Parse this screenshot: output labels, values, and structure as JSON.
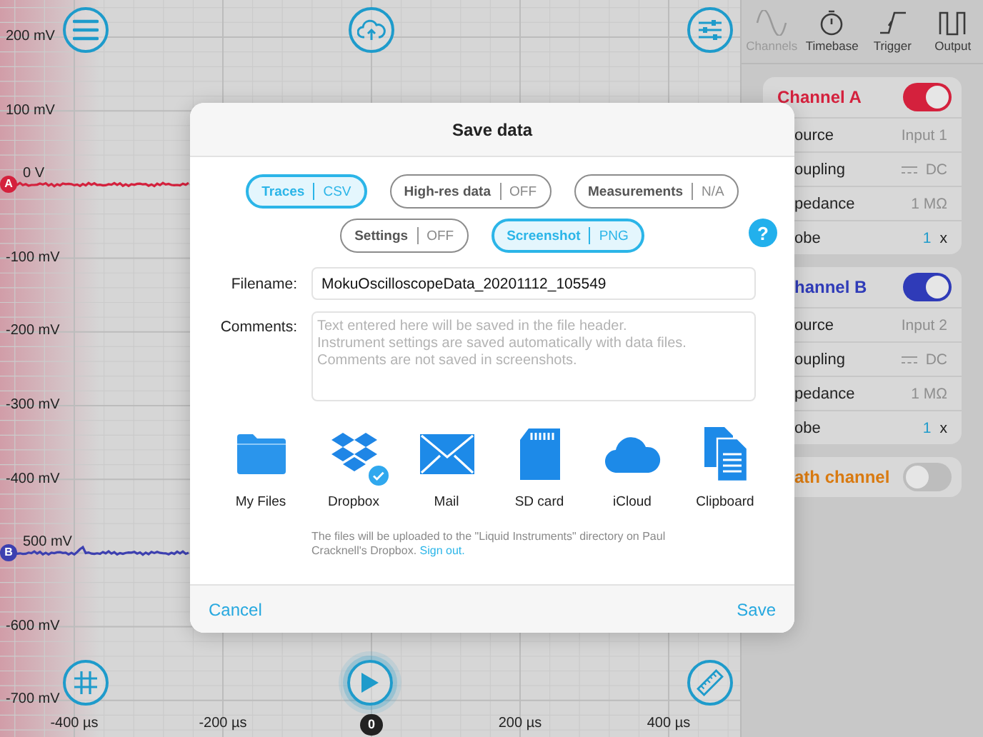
{
  "plot": {
    "y_labels": [
      {
        "text": "200 mV"
      },
      {
        "text": "100 mV"
      },
      {
        "text": "0 V",
        "trace": {
          "marker": "A",
          "color": "#d4213d"
        }
      },
      {
        "text": "-100 mV"
      },
      {
        "text": "-200 mV"
      },
      {
        "text": "-300 mV"
      },
      {
        "text": "-400 mV"
      },
      {
        "text": "500 mV",
        "trace": {
          "marker": "B",
          "color": "#3d40b0"
        }
      },
      {
        "text": "-600 mV"
      },
      {
        "text": "-700 mV"
      }
    ],
    "x_labels": [
      {
        "text": "-400 µs",
        "kind": "tick"
      },
      {
        "text": "-200 µs",
        "kind": "tick"
      },
      {
        "text": "0",
        "kind": "cursor"
      },
      {
        "text": "200 µs",
        "kind": "tick"
      },
      {
        "text": "400 µs",
        "kind": "tick"
      }
    ]
  },
  "panel": {
    "tabs": [
      {
        "label": "Channels",
        "kind": "sine",
        "selected": true
      },
      {
        "label": "Timebase",
        "kind": "stopwatch",
        "selected": false
      },
      {
        "label": "Trigger",
        "kind": "edge",
        "selected": false
      },
      {
        "label": "Output",
        "kind": "pulse",
        "selected": false
      }
    ],
    "channels": [
      {
        "title": "Channel A",
        "color": "#d4213d",
        "on": true,
        "rows": [
          {
            "kind": "text",
            "label": "ource",
            "value": "Input 1"
          },
          {
            "kind": "coupling",
            "label": "oupling",
            "value": "DC"
          },
          {
            "kind": "text",
            "label": "pedance",
            "value": "1 MΩ"
          },
          {
            "kind": "probe",
            "label": "obe",
            "value": "1",
            "unit": "x"
          }
        ]
      },
      {
        "title": "hannel B",
        "color": "#2f3bb8",
        "on": true,
        "rows": [
          {
            "kind": "text",
            "label": "ource",
            "value": "Input 2"
          },
          {
            "kind": "coupling",
            "label": "oupling",
            "value": "DC"
          },
          {
            "kind": "text",
            "label": "pedance",
            "value": "1 MΩ"
          },
          {
            "kind": "probe",
            "label": "obe",
            "value": "1",
            "unit": "x"
          }
        ]
      },
      {
        "title": "ath channel",
        "color": "#d97a10",
        "on": false
      }
    ]
  },
  "dialog": {
    "title": "Save data",
    "help": "?",
    "options": [
      {
        "label": "Traces",
        "value": "CSV",
        "selected": true
      },
      {
        "label": "High-res data",
        "value": "OFF",
        "selected": false
      },
      {
        "label": "Measurements",
        "value": "N/A",
        "selected": false
      },
      {
        "label": "Settings",
        "value": "OFF",
        "selected": false
      },
      {
        "label": "Screenshot",
        "value": "PNG",
        "selected": true
      }
    ],
    "filename": {
      "label": "Filename:",
      "value": "MokuOscilloscopeData_20201112_105549"
    },
    "comments": {
      "label": "Comments:",
      "placeholder": "Text entered here will be saved in the file header.\nInstrument settings are saved automatically with data files.\nComments are not saved in screenshots."
    },
    "destinations": [
      {
        "label": "My Files",
        "kind": "folder",
        "selected": false
      },
      {
        "label": "Dropbox",
        "kind": "boxes",
        "selected": true
      },
      {
        "label": "Mail",
        "kind": "mail",
        "selected": false
      },
      {
        "label": "SD card",
        "kind": "sdcard",
        "selected": false
      },
      {
        "label": "iCloud",
        "kind": "cloud",
        "selected": false
      },
      {
        "label": "Clipboard",
        "kind": "clipboard",
        "selected": false
      }
    ],
    "note": {
      "text": "The files will be uploaded to the \"Liquid Instruments\" directory on Paul Cracknell's Dropbox.",
      "link": "Sign out."
    },
    "cancel": "Cancel",
    "save": "Save"
  }
}
